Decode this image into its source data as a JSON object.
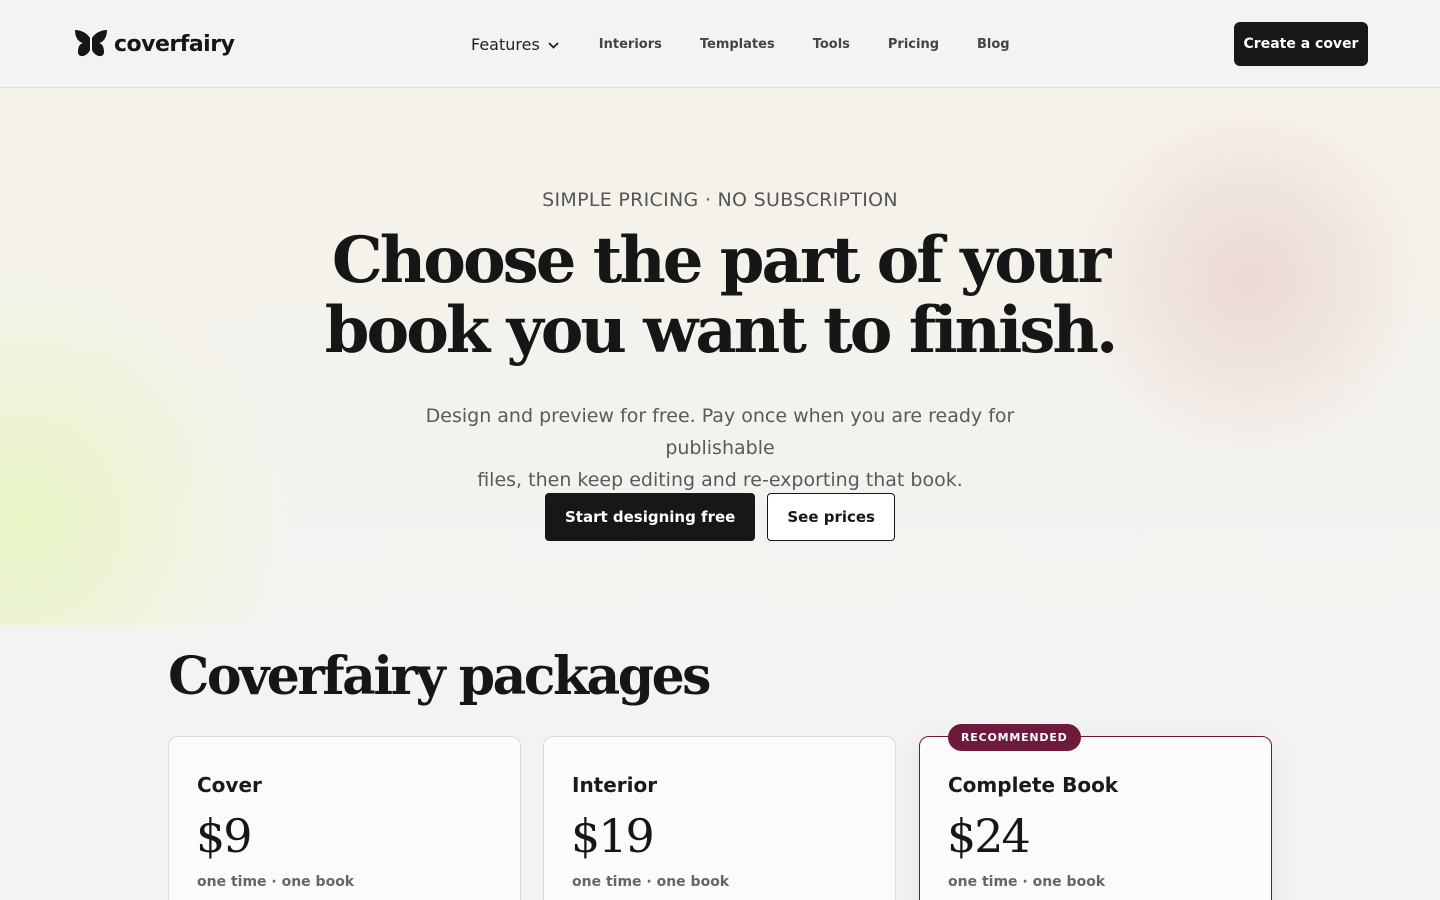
{
  "brand": {
    "name": "coverfairy"
  },
  "nav": {
    "features_label": "Features",
    "links": [
      "Interiors",
      "Templates",
      "Tools",
      "Pricing",
      "Blog"
    ],
    "cta_label": "Create a cover"
  },
  "hero": {
    "eyebrow": "SIMPLE PRICING · NO SUBSCRIPTION",
    "title_line1": "Choose the part of your",
    "title_line2": "book you want to finish.",
    "subtitle_line1": "Design and preview for free. Pay once when you are ready for publishable",
    "subtitle_line2": "files, then keep editing and re-exporting that book.",
    "primary_button": "Start designing free",
    "secondary_button": "See prices"
  },
  "packages": {
    "title": "Coverfairy packages",
    "badge": "RECOMMENDED",
    "cards": [
      {
        "name": "Cover",
        "price": "$9",
        "note": "one time · one book"
      },
      {
        "name": "Interior",
        "price": "$19",
        "note": "one time · one book"
      },
      {
        "name": "Complete Book",
        "price": "$24",
        "note": "one time · one book"
      }
    ]
  },
  "colors": {
    "accent": "#6e1a3b",
    "dark": "#171717",
    "background": "#f4f3f1"
  },
  "icons": {
    "logo": "butterfly-icon",
    "features_chevron": "chevron-down-icon"
  }
}
